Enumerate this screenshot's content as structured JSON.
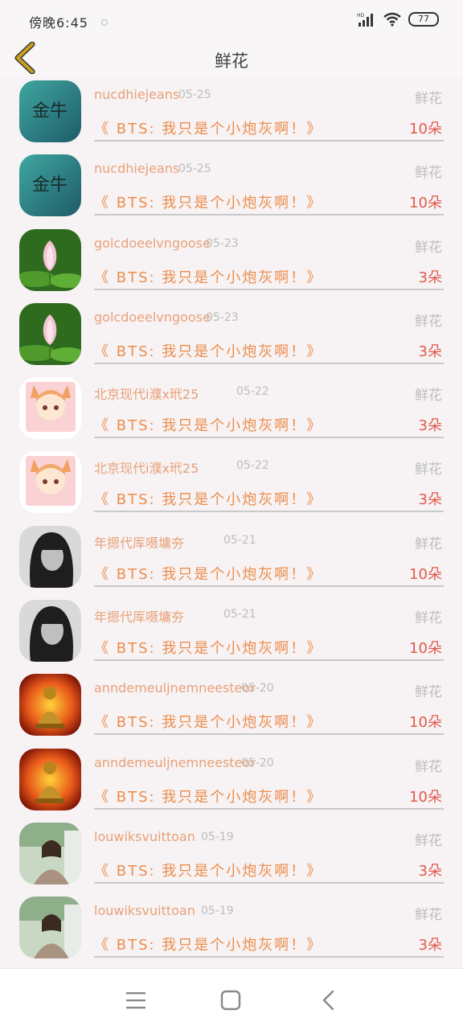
{
  "status_bar": {
    "time": "傍晚6:45",
    "battery": "77",
    "signal_icon": "signal-icon",
    "wifi_icon": "wifi-icon"
  },
  "header": {
    "title": "鲜花",
    "back_icon": "chevron-left-icon"
  },
  "items": [
    {
      "username": "nucdhiejeans",
      "date": "05-25",
      "category": "鲜花",
      "gift_title": "《 BTS: 我只是个小炮灰啊！》",
      "count": "10朵",
      "avatar": "gold-text-avatar"
    },
    {
      "username": "nucdhiejeans",
      "date": "05-25",
      "category": "鲜花",
      "gift_title": "《 BTS: 我只是个小炮灰啊！》",
      "count": "10朵",
      "avatar": "gold-text-avatar"
    },
    {
      "username": "golcdoeelvngoose",
      "date": "05-23",
      "category": "鲜花",
      "gift_title": "《 BTS: 我只是个小炮灰啊！》",
      "count": "3朵",
      "avatar": "lotus-avatar"
    },
    {
      "username": "golcdoeelvngoose",
      "date": "05-23",
      "category": "鲜花",
      "gift_title": "《 BTS: 我只是个小炮灰啊！》",
      "count": "3朵",
      "avatar": "lotus-avatar"
    },
    {
      "username": "北京现代i濮x玳25",
      "date": "05-22",
      "category": "鲜花",
      "gift_title": "《 BTS: 我只是个小炮灰啊！》",
      "count": "3朵",
      "avatar": "fox-girl-avatar"
    },
    {
      "username": "北京现代i濮x玳25",
      "date": "05-22",
      "category": "鲜花",
      "gift_title": "《 BTS: 我只是个小炮灰啊！》",
      "count": "3朵",
      "avatar": "fox-girl-avatar"
    },
    {
      "username": "年摁代厍嗫墉夯",
      "date": "05-21",
      "category": "鲜花",
      "gift_title": "《 BTS: 我只是个小炮灰啊！》",
      "count": "10朵",
      "avatar": "bw-portrait-avatar"
    },
    {
      "username": "年摁代厍嗫墉夯",
      "date": "05-21",
      "category": "鲜花",
      "gift_title": "《 BTS: 我只是个小炮灰啊！》",
      "count": "10朵",
      "avatar": "bw-portrait-avatar"
    },
    {
      "username": "anndemeuljnemneesteor",
      "date": "05-20",
      "category": "鲜花",
      "gift_title": "《 BTS: 我只是个小炮灰啊！》",
      "count": "10朵",
      "avatar": "buddha-avatar"
    },
    {
      "username": "anndemeuljnemneesteor",
      "date": "05-20",
      "category": "鲜花",
      "gift_title": "《 BTS: 我只是个小炮灰啊！》",
      "count": "10朵",
      "avatar": "buddha-avatar"
    },
    {
      "username": "louwiksvuittoan",
      "date": "05-19",
      "category": "鲜花",
      "gift_title": "《 BTS: 我只是个小炮灰啊！》",
      "count": "3朵",
      "avatar": "girl-photo-avatar"
    },
    {
      "username": "louwiksvuittoan",
      "date": "05-19",
      "category": "鲜花",
      "gift_title": "《 BTS: 我只是个小炮灰啊！》",
      "count": "3朵",
      "avatar": "girl-photo-avatar"
    }
  ],
  "nav": {
    "menu_icon": "menu-icon",
    "home_icon": "home-square-icon",
    "back_icon": "back-triangle-icon"
  },
  "colors": {
    "username": "#e8a078",
    "gift_title": "#ec8c4c",
    "count": "#e0594c",
    "back_chevron": "#c9a020"
  }
}
